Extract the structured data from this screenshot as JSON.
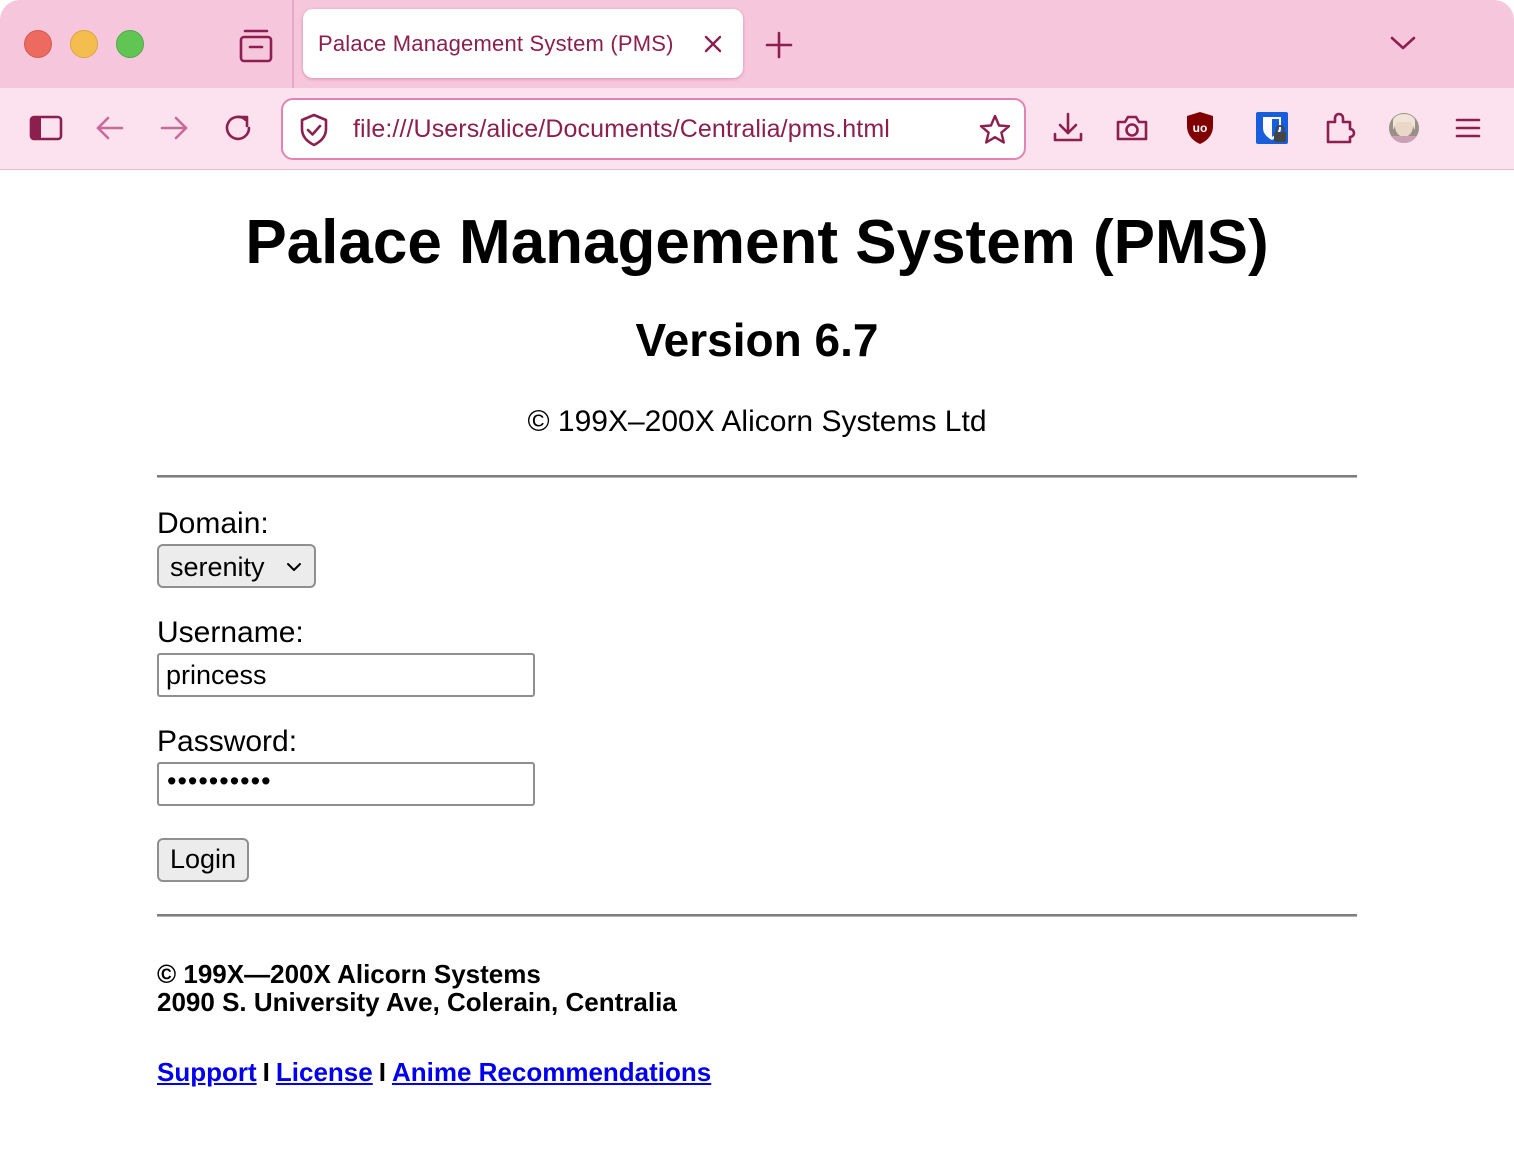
{
  "browser": {
    "tab_title": "Palace Management System (PMS)",
    "url": "file:///Users/alice/Documents/Centralia/pms.html",
    "colors": {
      "chrome": "#f6c6dc",
      "toolbar": "#fbe2ee",
      "accent": "#8d1f4e"
    },
    "icons": [
      "sidebar-icon",
      "back-icon",
      "forward-icon",
      "reload-icon",
      "shield-icon",
      "bookmark-star-icon",
      "download-icon",
      "screenshot-icon",
      "ublock-icon",
      "bitwarden-icon",
      "extensions-icon",
      "avatar",
      "menu-icon"
    ]
  },
  "page": {
    "title": "Palace Management System (PMS)",
    "version": "Version 6.7",
    "copyright_top": "© 199X–200X Alicorn Systems Ltd",
    "form": {
      "domain_label": "Domain:",
      "domain_value": "serenity",
      "username_label": "Username:",
      "username_value": "princess",
      "password_label": "Password:",
      "password_mask": "••••••••••",
      "login_label": "Login"
    },
    "footer": {
      "line1": "© 199X—200X Alicorn Systems",
      "line2": "2090 S. University Ave, Colerain, Centralia",
      "links": [
        "Support",
        "License",
        "Anime Recommendations"
      ],
      "separator": "I",
      "link_color": "#0000ee"
    }
  }
}
